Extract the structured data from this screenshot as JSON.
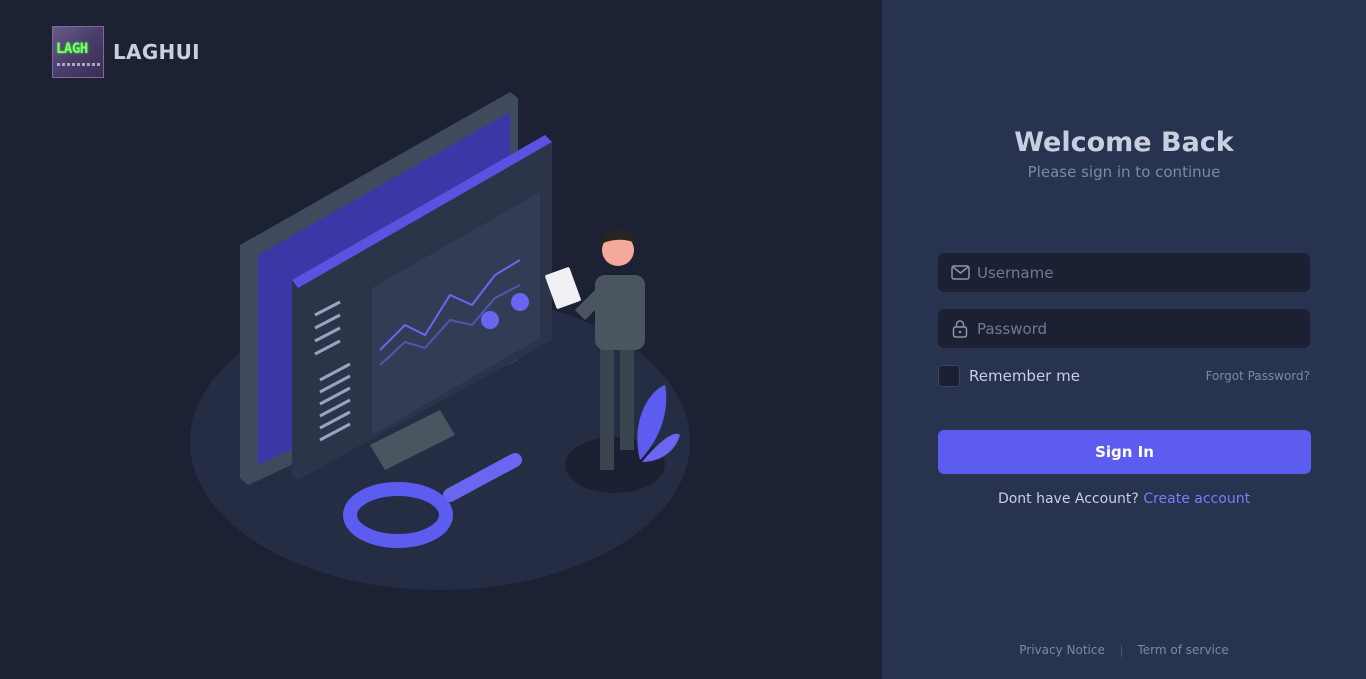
{
  "brand": {
    "name": "LAGHUI",
    "logo_text": "LAGH"
  },
  "login": {
    "title": "Welcome Back",
    "subtitle": "Please sign in to continue",
    "username_placeholder": "Username",
    "password_placeholder": "Password",
    "remember_label": "Remember me",
    "forgot_label": "Forgot Password?",
    "signin_label": "Sign In",
    "signup_prompt": "Dont have Account?",
    "signup_link": "Create account"
  },
  "footer": {
    "privacy_label": "Privacy Notice",
    "terms_label": "Term of service"
  },
  "icons": {
    "username": "envelope-icon",
    "password": "lock-icon"
  },
  "colors": {
    "accent": "#5c5cf0",
    "left_bg": "#1c2133",
    "right_bg": "#283350",
    "input_bg": "#1b2133",
    "link": "#7b7bff"
  }
}
